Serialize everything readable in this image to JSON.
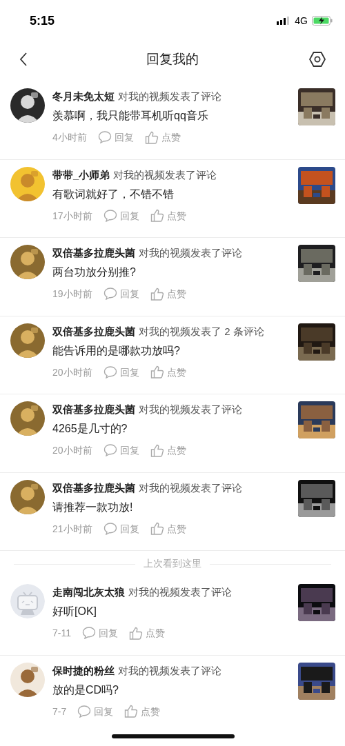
{
  "status_bar": {
    "time": "5:15",
    "network": "4G"
  },
  "header": {
    "title": "回复我的"
  },
  "notifications": [
    {
      "kind": "comment",
      "user": "冬月未免太短",
      "action": "对我的视频发表了评论",
      "comment": "羡慕啊，我只能带耳机听qq音乐",
      "time": "4小时前",
      "reply_label": "回复",
      "like_label": "点赞"
    },
    {
      "kind": "comment",
      "user": "带带_小师弟",
      "action": "对我的视频发表了评论",
      "comment": "有歌词就好了，不错不错",
      "time": "17小时前",
      "reply_label": "回复",
      "like_label": "点赞"
    },
    {
      "kind": "comment",
      "user": "双倍基多拉鹿头菌",
      "action": "对我的视频发表了评论",
      "comment": "两台功放分别推?",
      "time": "19小时前",
      "reply_label": "回复",
      "like_label": "点赞"
    },
    {
      "kind": "comment",
      "user": "双倍基多拉鹿头菌",
      "action": "对我的视频发表了 2 条评论",
      "comment": "能告诉用的是哪款功放吗?",
      "time": "20小时前",
      "reply_label": "回复",
      "like_label": "点赞"
    },
    {
      "kind": "comment",
      "user": "双倍基多拉鹿头菌",
      "action": "对我的视频发表了评论",
      "comment": "4265是几寸的?",
      "time": "20小时前",
      "reply_label": "回复",
      "like_label": "点赞"
    },
    {
      "kind": "comment",
      "user": "双倍基多拉鹿头菌",
      "action": "对我的视频发表了评论",
      "comment": "请推荐一款功放!",
      "time": "21小时前",
      "reply_label": "回复",
      "like_label": "点赞"
    },
    {
      "kind": "separator",
      "label": "上次看到这里"
    },
    {
      "kind": "comment",
      "avatar": {
        "kind": "default"
      },
      "user": "走南闯北灰太狼",
      "action": "对我的视频发表了评论",
      "comment": "好听[OK]",
      "time": "7-11",
      "reply_label": "回复",
      "like_label": "点赞"
    },
    {
      "kind": "comment",
      "user": "保时捷的粉丝",
      "action": "对我的视频发表了评论",
      "comment": "放的是CD吗?",
      "time": "7-7",
      "reply_label": "回复",
      "like_label": "点赞"
    }
  ]
}
